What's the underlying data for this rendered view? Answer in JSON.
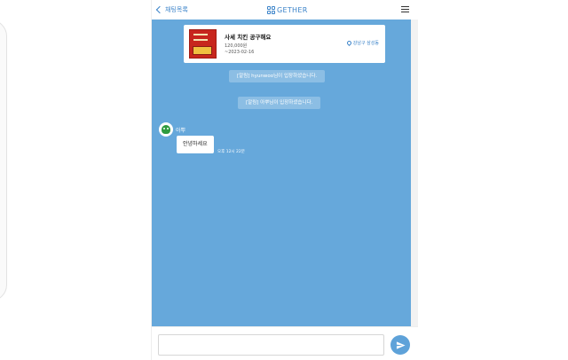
{
  "header": {
    "back_label": "채팅목록",
    "brand": "GETHER"
  },
  "product": {
    "title": "사세 치킨 공구해요",
    "price": "120,000원",
    "date": "~2023-02-16",
    "location": "강남구 삼성동"
  },
  "notices": [
    "[알림] hyunwoo님이 입장하셨습니다.",
    "[알림] 아뿌님이 입장하셨습니다."
  ],
  "messages": [
    {
      "sender": "아뿌",
      "text": "안녕하세요",
      "time": "오후 12시 22분"
    }
  ],
  "composer": {
    "value": "",
    "placeholder": ""
  },
  "colors": {
    "chat_background": "#66a8db",
    "accent": "#3b83c9",
    "send_button": "#5ea2d9"
  },
  "icons": {
    "back": "chevron-left-icon",
    "menu": "hamburger-menu-icon",
    "location": "map-pin-icon",
    "send": "paper-plane-icon",
    "brand": "gether-logo-icon"
  }
}
